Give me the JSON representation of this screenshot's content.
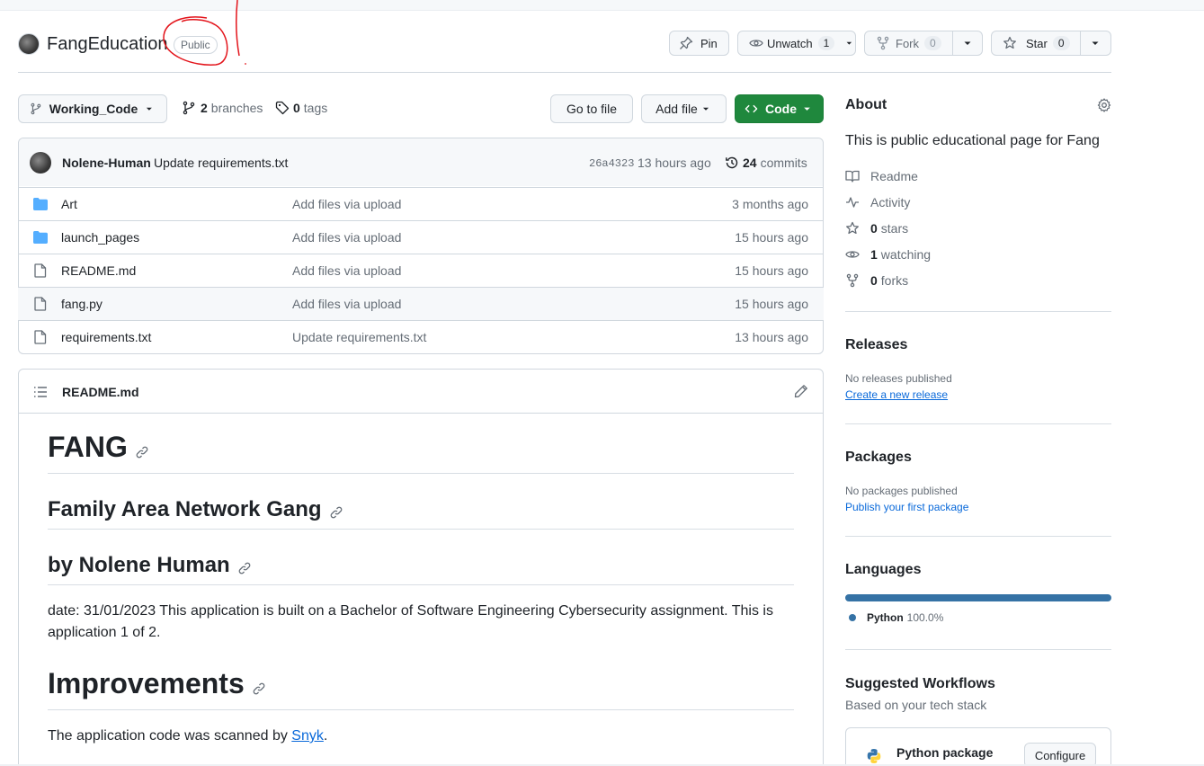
{
  "repo": {
    "name": "FangEducation",
    "visibility": "Public"
  },
  "actions": {
    "pin": "Pin",
    "unwatch": "Unwatch",
    "unwatch_count": "1",
    "fork": "Fork",
    "fork_count": "0",
    "star": "Star",
    "star_count": "0"
  },
  "branchbar": {
    "branch": "Working_Code",
    "branches_count": "2",
    "branches_label": "branches",
    "tags_count": "0",
    "tags_label": "tags",
    "go_to_file": "Go to file",
    "add_file": "Add file",
    "code": "Code"
  },
  "latest_commit": {
    "author": "Nolene-Human",
    "message": "Update requirements.txt",
    "sha": "26a4323",
    "time": "13 hours ago",
    "commits_count": "24",
    "commits_label": "commits"
  },
  "files": [
    {
      "type": "folder",
      "name": "Art",
      "message": "Add files via upload",
      "age": "3 months ago"
    },
    {
      "type": "folder",
      "name": "launch_pages",
      "message": "Add files via upload",
      "age": "15 hours ago"
    },
    {
      "type": "file",
      "name": "README.md",
      "message": "Add files via upload",
      "age": "15 hours ago"
    },
    {
      "type": "file",
      "name": "fang.py",
      "message": "Add files via upload",
      "age": "15 hours ago"
    },
    {
      "type": "file",
      "name": "requirements.txt",
      "message": "Update requirements.txt",
      "age": "13 hours ago"
    }
  ],
  "readme": {
    "filename": "README.md",
    "h1": "FANG",
    "h2a": "Family Area Network Gang",
    "h2b": "by Nolene Human",
    "para": "date: 31/01/2023 This application is built on a Bachelor of Software Engineering Cybersecurity assignment. This is application 1 of 2.",
    "h1b": "Improvements",
    "scan_prefix": "The application code was scanned by ",
    "scan_link": "Snyk",
    "scan_suffix": "."
  },
  "about": {
    "title": "About",
    "description": "This is public educational page for Fang",
    "readme": "Readme",
    "activity": "Activity",
    "stars_count": "0",
    "stars_label": "stars",
    "watching_count": "1",
    "watching_label": "watching",
    "forks_count": "0",
    "forks_label": "forks"
  },
  "releases": {
    "title": "Releases",
    "empty": "No releases published",
    "link": "Create a new release"
  },
  "packages": {
    "title": "Packages",
    "empty": "No packages published",
    "link": "Publish your first package"
  },
  "languages": {
    "title": "Languages",
    "items": [
      {
        "name": "Python",
        "percent": "100.0%",
        "color": "#3572A5"
      }
    ]
  },
  "workflows": {
    "title": "Suggested Workflows",
    "subtitle": "Based on your tech stack",
    "item_name": "Python package",
    "configure": "Configure"
  },
  "colors": {
    "accent_green": "#1f883d",
    "link_blue": "#0969da",
    "annotation_red": "#e3141b",
    "folder_blue": "#54aeff"
  },
  "icons": [
    "avatar",
    "pin-icon",
    "eye-icon",
    "fork-icon",
    "star-icon",
    "chevron-down-icon",
    "branch-icon",
    "tag-icon",
    "code-icon",
    "history-icon",
    "folder-icon",
    "file-icon",
    "list-icon",
    "pencil-icon",
    "link-icon",
    "gear-icon",
    "book-icon",
    "pulse-icon",
    "python-logo"
  ]
}
